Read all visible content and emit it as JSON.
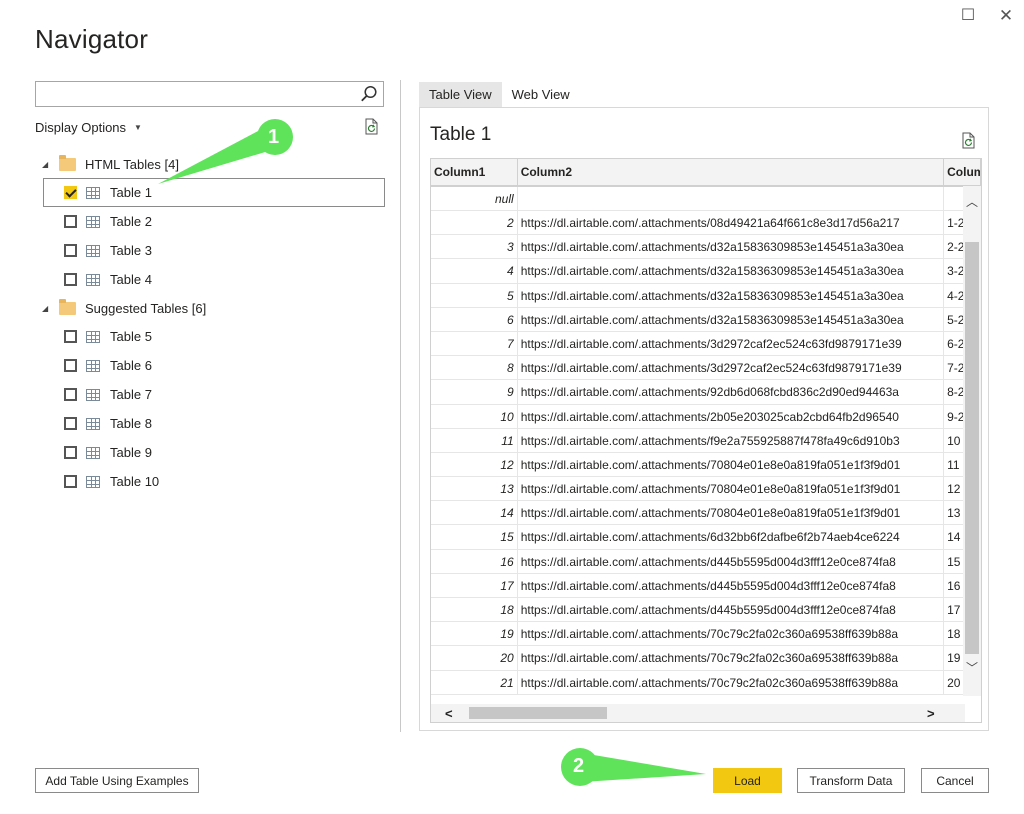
{
  "window": {
    "maximize_glyph": "☐",
    "close_glyph": "✕"
  },
  "title": "Navigator",
  "left_pane": {
    "search": {
      "value": "",
      "placeholder": ""
    },
    "display_options_label": "Display Options",
    "groups": [
      {
        "label": "HTML Tables [4]",
        "items": [
          {
            "label": "Table 1",
            "checked": true,
            "selected": true
          },
          {
            "label": "Table 2",
            "checked": false
          },
          {
            "label": "Table 3",
            "checked": false
          },
          {
            "label": "Table 4",
            "checked": false
          }
        ]
      },
      {
        "label": "Suggested Tables [6]",
        "items": [
          {
            "label": "Table 5",
            "checked": false
          },
          {
            "label": "Table 6",
            "checked": false
          },
          {
            "label": "Table 7",
            "checked": false
          },
          {
            "label": "Table 8",
            "checked": false
          },
          {
            "label": "Table 9",
            "checked": false
          },
          {
            "label": "Table 10",
            "checked": false
          }
        ]
      }
    ]
  },
  "right_pane": {
    "tabs": [
      "Table View",
      "Web View"
    ],
    "active_tab": "Table View",
    "preview_title": "Table 1",
    "columns": [
      "Column1",
      "Column2",
      "Colum"
    ],
    "rows": [
      {
        "c1": "null",
        "c2": "",
        "c3": ""
      },
      {
        "c1": "2",
        "c2": "https://dl.airtable.com/.attachments/08d49421a64f661c8e3d17d56a217",
        "c3": "1-2"
      },
      {
        "c1": "3",
        "c2": "https://dl.airtable.com/.attachments/d32a15836309853e145451a3a30ea",
        "c3": "2-2"
      },
      {
        "c1": "4",
        "c2": "https://dl.airtable.com/.attachments/d32a15836309853e145451a3a30ea",
        "c3": "3-2"
      },
      {
        "c1": "5",
        "c2": "https://dl.airtable.com/.attachments/d32a15836309853e145451a3a30ea",
        "c3": "4-2"
      },
      {
        "c1": "6",
        "c2": "https://dl.airtable.com/.attachments/d32a15836309853e145451a3a30ea",
        "c3": "5-2"
      },
      {
        "c1": "7",
        "c2": "https://dl.airtable.com/.attachments/3d2972caf2ec524c63fd9879171e39",
        "c3": "6-2"
      },
      {
        "c1": "8",
        "c2": "https://dl.airtable.com/.attachments/3d2972caf2ec524c63fd9879171e39",
        "c3": "7-2"
      },
      {
        "c1": "9",
        "c2": "https://dl.airtable.com/.attachments/92db6d068fcbd836c2d90ed94463a",
        "c3": "8-2"
      },
      {
        "c1": "10",
        "c2": "https://dl.airtable.com/.attachments/2b05e203025cab2cbd64fb2d96540",
        "c3": "9-2"
      },
      {
        "c1": "11",
        "c2": "https://dl.airtable.com/.attachments/f9e2a755925887f478fa49c6d910b3",
        "c3": "10"
      },
      {
        "c1": "12",
        "c2": "https://dl.airtable.com/.attachments/70804e01e8e0a819fa051e1f3f9d01",
        "c3": "11"
      },
      {
        "c1": "13",
        "c2": "https://dl.airtable.com/.attachments/70804e01e8e0a819fa051e1f3f9d01",
        "c3": "12"
      },
      {
        "c1": "14",
        "c2": "https://dl.airtable.com/.attachments/70804e01e8e0a819fa051e1f3f9d01",
        "c3": "13"
      },
      {
        "c1": "15",
        "c2": "https://dl.airtable.com/.attachments/6d32bb6f2dafbe6f2b74aeb4ce6224",
        "c3": "14"
      },
      {
        "c1": "16",
        "c2": "https://dl.airtable.com/.attachments/d445b5595d004d3fff12e0ce874fa8",
        "c3": "15"
      },
      {
        "c1": "17",
        "c2": "https://dl.airtable.com/.attachments/d445b5595d004d3fff12e0ce874fa8",
        "c3": "16"
      },
      {
        "c1": "18",
        "c2": "https://dl.airtable.com/.attachments/d445b5595d004d3fff12e0ce874fa8",
        "c3": "17"
      },
      {
        "c1": "19",
        "c2": "https://dl.airtable.com/.attachments/70c79c2fa02c360a69538ff639b88a",
        "c3": "18"
      },
      {
        "c1": "20",
        "c2": "https://dl.airtable.com/.attachments/70c79c2fa02c360a69538ff639b88a",
        "c3": "19"
      },
      {
        "c1": "21",
        "c2": "https://dl.airtable.com/.attachments/70c79c2fa02c360a69538ff639b88a",
        "c3": "20"
      }
    ]
  },
  "buttons": {
    "add_examples": "Add Table Using Examples",
    "load": "Load",
    "transform": "Transform Data",
    "cancel": "Cancel"
  },
  "callouts": [
    {
      "number": "1"
    },
    {
      "number": "2"
    }
  ],
  "colors": {
    "accent": "#f2c811",
    "callout_green": "#5fe35a"
  }
}
